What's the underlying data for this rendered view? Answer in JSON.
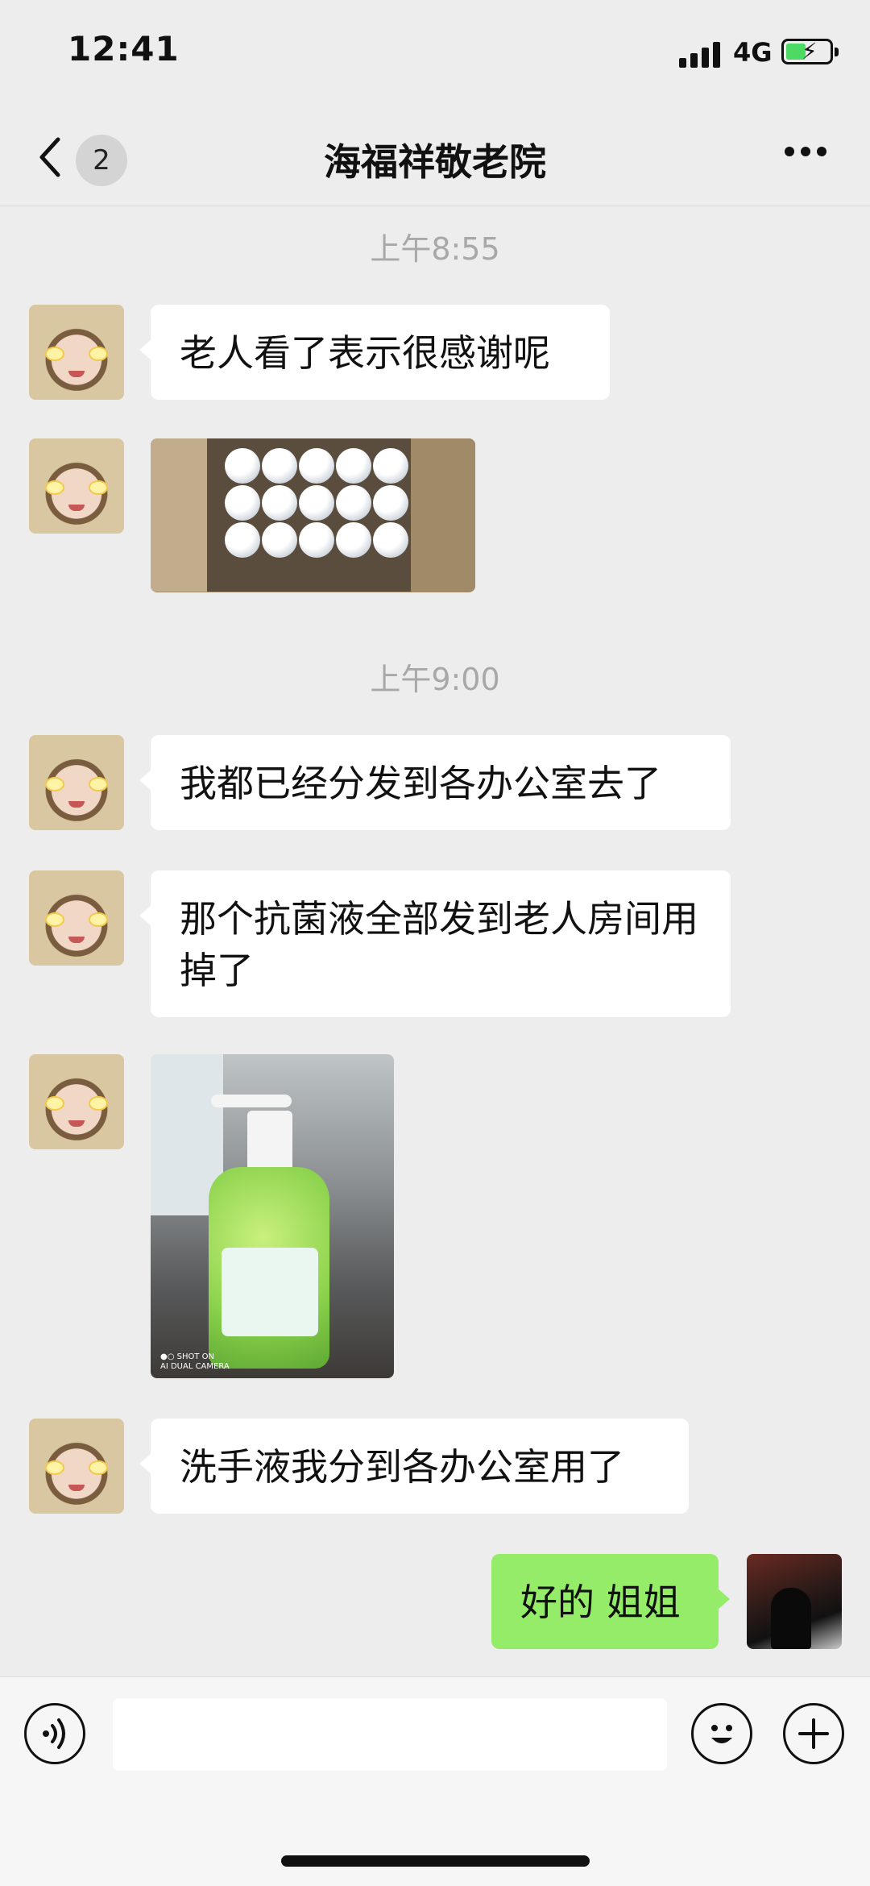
{
  "status_bar": {
    "time": "12:41",
    "network": "4G"
  },
  "nav": {
    "unread_count": "2",
    "title": "海福祥敬老院"
  },
  "messages": [
    {
      "type": "timestamp",
      "text": "上午8:55"
    },
    {
      "type": "text",
      "from": "other",
      "text": "老人看了表示很感谢呢"
    },
    {
      "type": "image",
      "from": "other",
      "content": "box-of-white-bottles"
    },
    {
      "type": "timestamp",
      "text": "上午9:00"
    },
    {
      "type": "text",
      "from": "other",
      "text": "我都已经分发到各办公室去了"
    },
    {
      "type": "text",
      "from": "other",
      "text": "那个抗菌液全部发到老人房间用掉了"
    },
    {
      "type": "image",
      "from": "other",
      "content": "hand-sanitizer-bottle"
    },
    {
      "type": "text",
      "from": "other",
      "text": "洗手液我分到各办公室用了"
    },
    {
      "type": "text",
      "from": "me",
      "text": "好的 姐姐"
    }
  ],
  "colors": {
    "outgoing_bubble": "#95ec69",
    "incoming_bubble": "#ffffff",
    "background": "#ededed"
  },
  "icons": [
    "back-chevron-icon",
    "more-icon",
    "voice-icon",
    "emoji-icon",
    "plus-icon"
  ]
}
